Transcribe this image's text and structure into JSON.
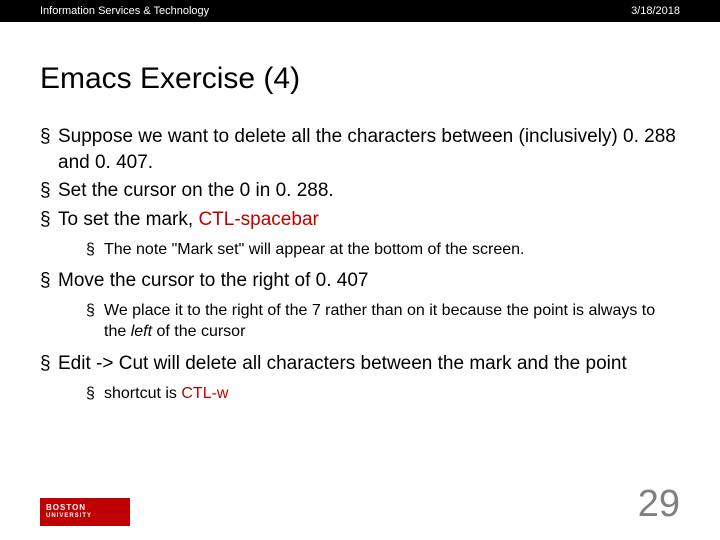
{
  "header": {
    "left": "Information Services & Technology",
    "right": "3/18/2018"
  },
  "title": "Emacs Exercise (4)",
  "bullets": {
    "b1": "Suppose we want to delete all the characters between (inclusively) 0. 288 and 0. 407.",
    "b2": "Set the cursor on the 0 in 0. 288.",
    "b3a": "To set the mark, ",
    "b3b": "CTL-spacebar",
    "b3s1": "The note \"Mark set\" will appear at the bottom of the screen.",
    "b4": "Move the cursor to the right of 0. 407",
    "b4s1a": "We place it to the right of the 7 rather than on it because the point is always to the ",
    "b4s1b": "left",
    "b4s1c": " of the cursor",
    "b5": "Edit -> Cut will delete all characters between the mark and the point",
    "b5s1a": "shortcut is ",
    "b5s1b": "CTL-w"
  },
  "logo": {
    "line1": "BOSTON",
    "line2": "UNIVERSITY"
  },
  "pagenum": "29"
}
